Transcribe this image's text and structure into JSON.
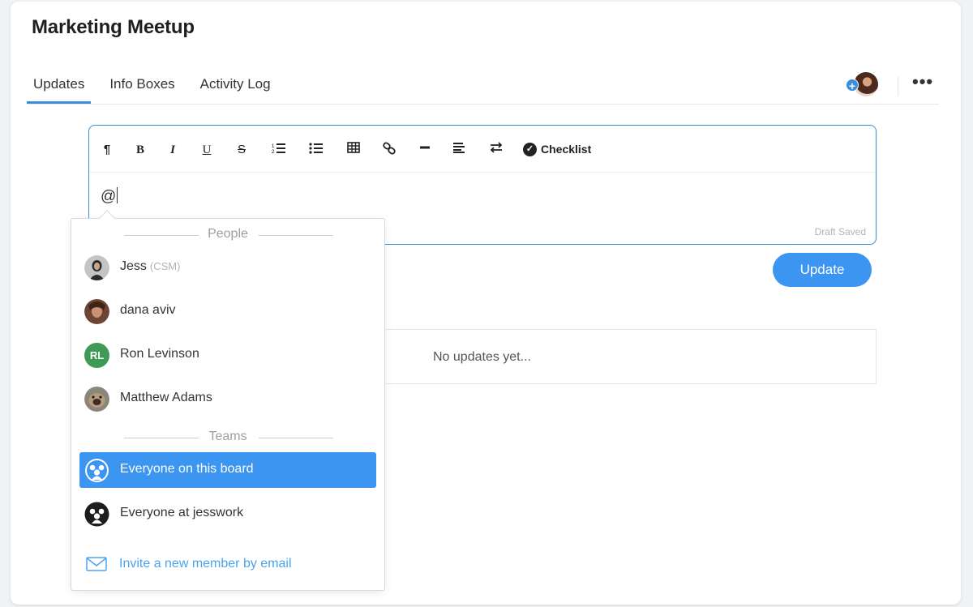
{
  "page": {
    "title": "Marketing Meetup"
  },
  "tabs": [
    {
      "label": "Updates",
      "active": true
    },
    {
      "label": "Info Boxes",
      "active": false
    },
    {
      "label": "Activity Log",
      "active": false
    }
  ],
  "header": {
    "add_badge": "+",
    "more_label": "•••"
  },
  "toolbar": {
    "paragraph": "¶",
    "bold": "B",
    "italic": "I",
    "underline": "U",
    "strike": "S",
    "checklist_label": "Checklist",
    "checklist_icon": "✓"
  },
  "editor": {
    "text": "@",
    "draft_status": "Draft Saved"
  },
  "update_button": "Update",
  "feed": {
    "empty_text": "No updates yet..."
  },
  "mention": {
    "people_heading": "People",
    "teams_heading": "Teams",
    "people": [
      {
        "name": "Jess",
        "role": "(CSM)",
        "avatar": "photo"
      },
      {
        "name": "dana aviv",
        "role": "",
        "avatar": "photo"
      },
      {
        "name": "Ron Levinson",
        "role": "",
        "avatar": "initials",
        "initials": "RL",
        "color": "#3f9a55"
      },
      {
        "name": "Matthew Adams",
        "role": "",
        "avatar": "photo"
      }
    ],
    "teams": [
      {
        "name": "Everyone on this board",
        "selected": true
      },
      {
        "name": "Everyone at jesswork",
        "selected": false
      }
    ],
    "invite_label": "Invite a new member by email"
  },
  "colors": {
    "accent": "#3b95f1",
    "selected_bg": "#3b95f1",
    "link": "#4aa3f0"
  }
}
